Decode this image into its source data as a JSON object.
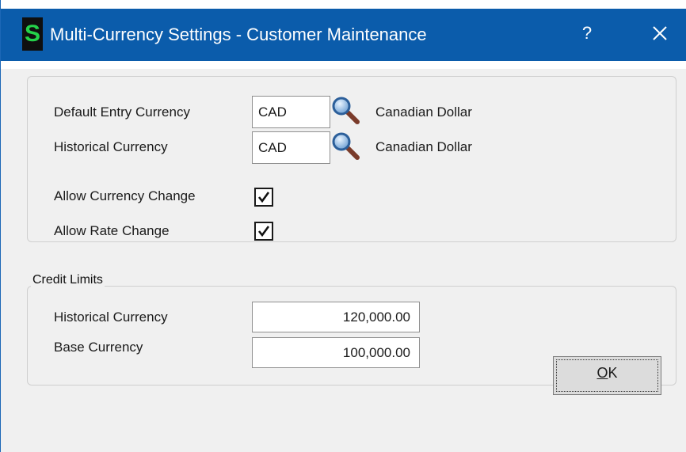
{
  "window": {
    "title": "Multi-Currency Settings - Customer Maintenance",
    "icon_letter": "S",
    "help_label": "?",
    "close_label": "✕",
    "accent_color": "#0b5cab"
  },
  "currency": {
    "default_entry": {
      "label": "Default Entry Currency",
      "code": "CAD",
      "description": "Canadian Dollar"
    },
    "historical": {
      "label": "Historical Currency",
      "code": "CAD",
      "description": "Canadian Dollar"
    },
    "allow_currency_change": {
      "label": "Allow Currency Change",
      "checked": true
    },
    "allow_rate_change": {
      "label": "Allow Rate Change",
      "checked": true
    }
  },
  "credit_limits": {
    "caption": "Credit Limits",
    "historical": {
      "label": "Historical Currency",
      "value": "120,000.00"
    },
    "base": {
      "label": "Base Currency",
      "value": "100,000.00"
    }
  },
  "buttons": {
    "ok_mnemonic": "O",
    "ok_rest": "K"
  },
  "icons": {
    "lookup": "magnifier-icon",
    "checkmark": "checkmark-icon"
  }
}
